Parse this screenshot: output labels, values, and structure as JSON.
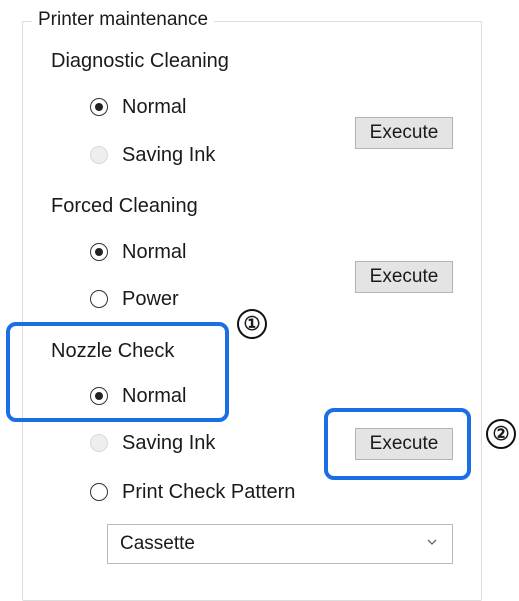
{
  "group": {
    "title": "Printer maintenance"
  },
  "diagnostic": {
    "title": "Diagnostic Cleaning",
    "options": [
      {
        "label": "Normal",
        "checked": true,
        "enabled": true
      },
      {
        "label": "Saving Ink",
        "checked": false,
        "enabled": false
      }
    ],
    "execute_label": "Execute"
  },
  "forced": {
    "title": "Forced Cleaning",
    "options": [
      {
        "label": "Normal",
        "checked": true,
        "enabled": true
      },
      {
        "label": "Power",
        "checked": false,
        "enabled": true
      }
    ],
    "execute_label": "Execute"
  },
  "nozzle": {
    "title": "Nozzle Check",
    "options": [
      {
        "label": "Normal",
        "checked": true,
        "enabled": true
      },
      {
        "label": "Saving Ink",
        "checked": false,
        "enabled": false
      },
      {
        "label": "Print Check Pattern",
        "checked": false,
        "enabled": true
      }
    ],
    "execute_label": "Execute",
    "tray_select": {
      "value": "Cassette"
    }
  },
  "callouts": {
    "one": "①",
    "two": "②"
  },
  "colors": {
    "highlight": "#1a6fe6",
    "button_bg": "#e4e4e4"
  }
}
